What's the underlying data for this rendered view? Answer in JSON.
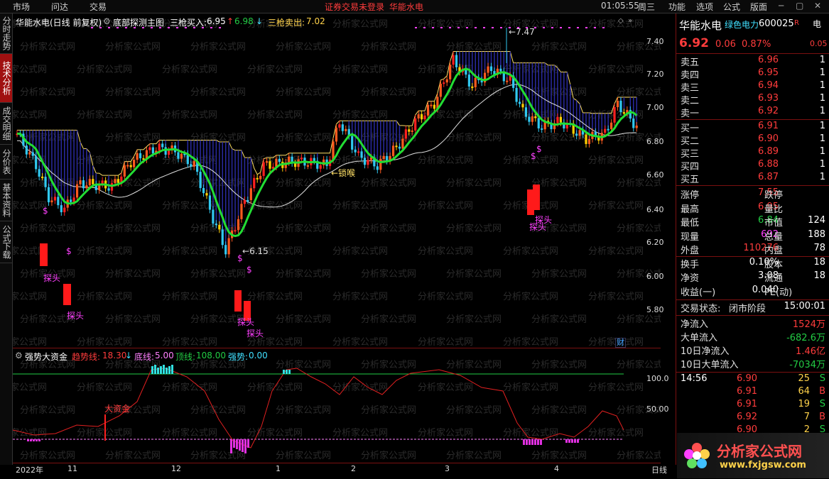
{
  "menubar": {
    "items": [
      "市场",
      "问达",
      "交易"
    ],
    "warning": "证券交易未登录",
    "stock_name": "华能水电",
    "time": "01:05:55",
    "weekday": "周三",
    "right_items": [
      "功能",
      "选项",
      "公式",
      "版面"
    ]
  },
  "left_tabs": [
    "分时走势",
    "技术分析",
    "成交明细",
    "分价表",
    "基本资料",
    "公式下载"
  ],
  "main_header": {
    "title": "华能水电(日线 前复权)",
    "indicator": "底部探测主图",
    "buy_label": "三枪买入:",
    "buy_value": "6.95",
    "buy_extra": "6.98",
    "sell_label": "三枪卖出:",
    "sell_value": "7.02"
  },
  "sub_header": {
    "name": "强势大资金",
    "trend_label": "趋势线:",
    "trend_value": "18.30",
    "bottom_label": "底线:",
    "bottom_value": "5.00",
    "top_label": "顶线:",
    "top_value": "108.00",
    "strength_label": "强势:",
    "strength_value": "0.00"
  },
  "main_annotations": {
    "high_mark": "7.47",
    "low_mark": "6.15",
    "lock_label": "←锁喉",
    "probe": "探头",
    "dollar": "$",
    "finance_badge": "财",
    "big_money": "大资金"
  },
  "y_axis_main": [
    "7.40",
    "7.20",
    "7.00",
    "6.80",
    "6.60",
    "6.40",
    "6.20",
    "6.00",
    "5.80"
  ],
  "y_axis_sub": [
    "100.0",
    "50.00"
  ],
  "x_axis": [
    "2022年",
    "11",
    "12",
    "1",
    "2",
    "3",
    "4"
  ],
  "period": "日线",
  "watermark": "分析家公式网",
  "quote": {
    "name": "华能水电",
    "sector": "绿色电力",
    "code": "600025",
    "code_suffix": "R",
    "price": "6.92",
    "change": "0.06",
    "change_pct": "0.87%",
    "corner_top": "电",
    "corner_bottom": "0.05",
    "sells": [
      {
        "label": "卖五",
        "price": "6.96",
        "vol": "1"
      },
      {
        "label": "卖四",
        "price": "6.95",
        "vol": "1"
      },
      {
        "label": "卖三",
        "price": "6.94",
        "vol": "1"
      },
      {
        "label": "卖二",
        "price": "6.93",
        "vol": "1"
      },
      {
        "label": "卖一",
        "price": "6.92",
        "vol": "1"
      }
    ],
    "buys": [
      {
        "label": "买一",
        "price": "6.91",
        "vol": "1"
      },
      {
        "label": "买二",
        "price": "6.90",
        "vol": "1"
      },
      {
        "label": "买三",
        "price": "6.89",
        "vol": "1"
      },
      {
        "label": "买四",
        "price": "6.88",
        "vol": "1"
      },
      {
        "label": "买五",
        "price": "6.87",
        "vol": "1"
      }
    ],
    "stats": [
      {
        "l1": "涨停",
        "v1": "7.55",
        "c1": "red",
        "l2": "跌停",
        "v2": ""
      },
      {
        "l1": "最高",
        "v1": "6.95",
        "c1": "red",
        "l2": "量比",
        "v2": ""
      },
      {
        "l1": "最低",
        "v1": "6.84",
        "c1": "green",
        "l2": "市值",
        "v2": "124"
      },
      {
        "l1": "现量",
        "v1": "692",
        "c1": "magenta",
        "l2": "总量",
        "v2": "188"
      },
      {
        "l1": "外盘",
        "v1": "110276",
        "c1": "red",
        "l2": "内盘",
        "v2": "78"
      },
      {
        "l1": "换手",
        "v1": "0.10%",
        "c1": "white",
        "l2": "股本",
        "v2": "18"
      },
      {
        "l1": "净资",
        "v1": "3.08",
        "c1": "white",
        "l2": "流通",
        "v2": "18"
      },
      {
        "l1": "收益(一)",
        "v1": "0.040",
        "c1": "white",
        "l2": "PE(动)",
        "v2": ""
      }
    ],
    "status_label": "交易状态:",
    "status_value": "闭市阶段",
    "status_time": "15:00:01",
    "flows": [
      {
        "label": "净流入",
        "value": "1524万",
        "color": "red"
      },
      {
        "label": "大单流入",
        "value": "-682.6万",
        "color": "green"
      },
      {
        "label": "10日净流入",
        "value": "1.46亿",
        "color": "red"
      },
      {
        "label": "10日大单流入",
        "value": "-7034万",
        "color": "green"
      }
    ],
    "ticks": [
      {
        "time": "14:56",
        "price": "6.90",
        "vol": "25",
        "side": "S"
      },
      {
        "time": "",
        "price": "6.91",
        "vol": "64",
        "side": "B"
      },
      {
        "time": "",
        "price": "6.91",
        "vol": "19",
        "side": "S"
      },
      {
        "time": "",
        "price": "6.92",
        "vol": "7",
        "side": "B"
      },
      {
        "time": "",
        "price": "6.90",
        "vol": "2",
        "side": "S"
      }
    ]
  },
  "logo": {
    "text": "分析家公式网",
    "url_text": "www.fxjgsw.com"
  },
  "colors": {
    "up": "#ff3c3c",
    "down": "#40e0ff",
    "ma": "#22cc44",
    "line": "#ffe066"
  }
}
